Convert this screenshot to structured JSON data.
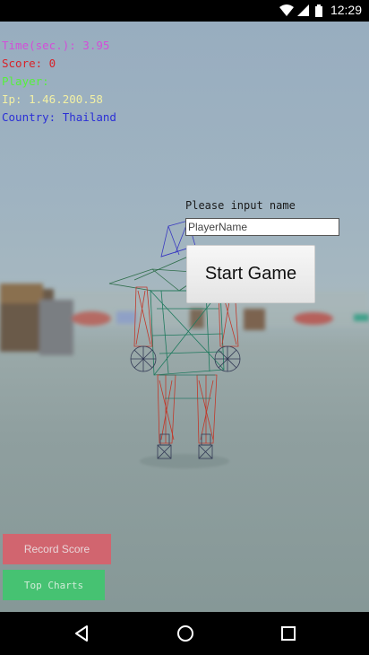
{
  "status_bar": {
    "time": "12:29",
    "icons": [
      "wifi-icon",
      "signal-icon",
      "battery-icon"
    ]
  },
  "hud": {
    "time": "Time(sec.): 3.95",
    "score": "Score: 0",
    "player": "Player:",
    "ip": "Ip: 1.46.200.58",
    "country": "Country: Thailand"
  },
  "name_form": {
    "prompt": "Please input name",
    "value": "PlayerName",
    "start_label": "Start Game"
  },
  "buttons": {
    "record_score": "Record Score",
    "top_charts": "Top Charts"
  },
  "nav_bar": {
    "icons": [
      "back-icon",
      "home-icon",
      "recent-apps-icon"
    ]
  },
  "colors": {
    "hud_time": "#d24fd8",
    "hud_score": "#d8232a",
    "hud_player": "#56f03c",
    "hud_ip": "#f2f0a4",
    "hud_country": "#2b2fd6",
    "record_button": "#d9606b",
    "charts_button": "#3fc76e"
  }
}
